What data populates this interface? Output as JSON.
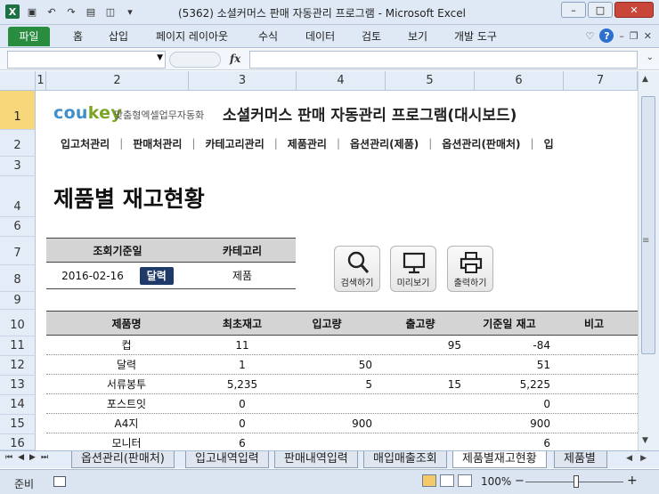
{
  "window": {
    "title": "(5362) 소셜커머스 판매 자동관리 프로그램 - Microsoft Excel",
    "minimize": "–",
    "maximize": "□",
    "close": "✕"
  },
  "ribbon": {
    "tabs": [
      "파일",
      "홈",
      "삽입",
      "페이지 레이아웃",
      "수식",
      "데이터",
      "검토",
      "보기",
      "개발 도구"
    ],
    "help": "?"
  },
  "formula_bar": {
    "fx": "fx",
    "name_box": "",
    "value": ""
  },
  "columns": [
    "1",
    "2",
    "3",
    "4",
    "5",
    "6",
    "7"
  ],
  "rows": [
    "1",
    "2",
    "3",
    "4",
    "6",
    "7",
    "8",
    "9",
    "10",
    "11",
    "12",
    "13",
    "14",
    "15",
    "16"
  ],
  "header": {
    "logo_cou": "cou",
    "logo_key": "key",
    "logo_sub": "맞춤형엑셀업무자동화",
    "app_title": "소셜커머스 판매 자동관리 프로그램(대시보드)"
  },
  "nav": {
    "items": [
      "입고처관리",
      "판매처관리",
      "카테고리관리",
      "제품관리",
      "옵션관리(제품)",
      "옵션관리(판매처)",
      "입"
    ]
  },
  "page_title": "제품별 재고현황",
  "query": {
    "col1_header": "조회기준일",
    "col2_header": "카테고리",
    "date": "2016-02-16",
    "date_button": "달력",
    "category": "제품"
  },
  "buttons": {
    "search": "검색하기",
    "preview": "미리보기",
    "print": "출력하기"
  },
  "table": {
    "headers": [
      "제품명",
      "최초재고",
      "입고량",
      "출고량",
      "기준일 재고",
      "비고"
    ],
    "rows": [
      [
        "컵",
        "11",
        "",
        "95",
        "-84",
        ""
      ],
      [
        "달력",
        "1",
        "50",
        "",
        "51",
        ""
      ],
      [
        "서류봉투",
        "5,235",
        "5",
        "15",
        "5,225",
        ""
      ],
      [
        "포스트잇",
        "0",
        "",
        "",
        "0",
        ""
      ],
      [
        "A4지",
        "0",
        "900",
        "",
        "900",
        ""
      ],
      [
        "모니터",
        "6",
        "",
        "",
        "6",
        ""
      ]
    ]
  },
  "sheet_tabs": [
    "옵션관리(판매처)",
    "입고내역입력",
    "판매내역입력",
    "매입매출조회",
    "제품별재고현황",
    "제품별"
  ],
  "status": {
    "ready": "준비",
    "zoom": "100%"
  }
}
